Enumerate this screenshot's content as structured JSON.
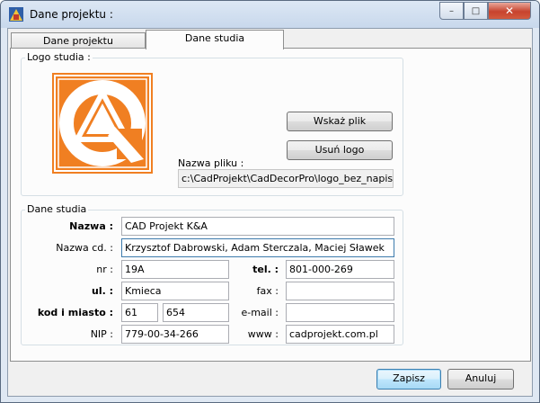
{
  "window": {
    "title": "Dane projektu :",
    "minimize_glyph": "–",
    "maximize_glyph": "□",
    "close_glyph": "✕"
  },
  "tabs": [
    {
      "label": "Dane projektu",
      "active": false
    },
    {
      "label": "Dane studia",
      "active": true
    }
  ],
  "logo_group": {
    "legend": "Logo studia :",
    "point_file_label": "Wskaż plik",
    "remove_logo_label": "Usuń logo",
    "file_name_label": "Nazwa pliku :",
    "file_name_value": "c:\\CadProjekt\\CadDecorPro\\logo_bez_napisu.jpg",
    "logo_color": "#f07f22"
  },
  "studio_group": {
    "legend": "Dane studia",
    "name_label": "Nazwa :",
    "name_value": "CAD Projekt K&A",
    "name_cd_label": "Nazwa cd. :",
    "name_cd_value": "Krzysztof Dabrowski, Adam Sterczala, Maciej Sławek",
    "nr_label": "nr :",
    "nr_value": "19A",
    "tel_label": "tel. :",
    "tel_value": "801-000-269",
    "street_label": "ul. :",
    "street_value": "Kmieca",
    "fax_label": "fax :",
    "fax_value": "",
    "postcode_city_label": "kod i miasto :",
    "postcode_value": "61",
    "city_value": "654",
    "email_label": "e-mail :",
    "email_value": "",
    "nip_label": "NIP :",
    "nip_value": "779-00-34-266",
    "www_label": "www :",
    "www_value": "cadprojekt.com.pl"
  },
  "dialog_buttons": {
    "save_label": "Zapisz",
    "cancel_label": "Anuluj"
  }
}
